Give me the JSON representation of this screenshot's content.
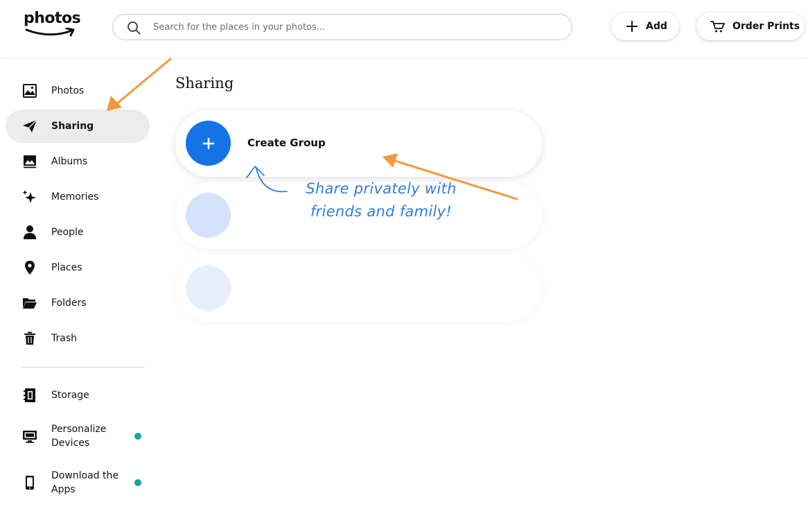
{
  "header": {
    "logo_text": "photos",
    "search": {
      "placeholder": "Search for the places in your photos..."
    },
    "add_label": "Add",
    "order_prints_label": "Order Prints"
  },
  "sidebar": {
    "items": [
      {
        "label": "Photos",
        "icon": "image-icon"
      },
      {
        "label": "Sharing",
        "icon": "paper-plane-icon",
        "active": true
      },
      {
        "label": "Albums",
        "icon": "album-icon"
      },
      {
        "label": "Memories",
        "icon": "sparkle-icon"
      },
      {
        "label": "People",
        "icon": "person-icon"
      },
      {
        "label": "Places",
        "icon": "location-pin-icon"
      },
      {
        "label": "Folders",
        "icon": "folder-icon"
      },
      {
        "label": "Trash",
        "icon": "trash-icon"
      }
    ],
    "secondary": [
      {
        "label": "Storage",
        "icon": "storage-icon"
      },
      {
        "label": "Personalize Devices",
        "icon": "monitor-icon",
        "badge": true
      },
      {
        "label": "Download the Apps",
        "icon": "phone-icon",
        "badge": true
      }
    ]
  },
  "main": {
    "title": "Sharing",
    "create_group_label": "Create Group",
    "annotation": "Share privately with friends and family!"
  },
  "colors": {
    "primary_blue": "#1673e6",
    "placeholder_blue_1": "#d3e3fb",
    "placeholder_blue_2": "#e6effc",
    "arrow_orange": "#f3983e",
    "annotation_blue": "#2e7de0",
    "badge_teal": "#16a59a",
    "active_nav_bg": "#ececec"
  }
}
